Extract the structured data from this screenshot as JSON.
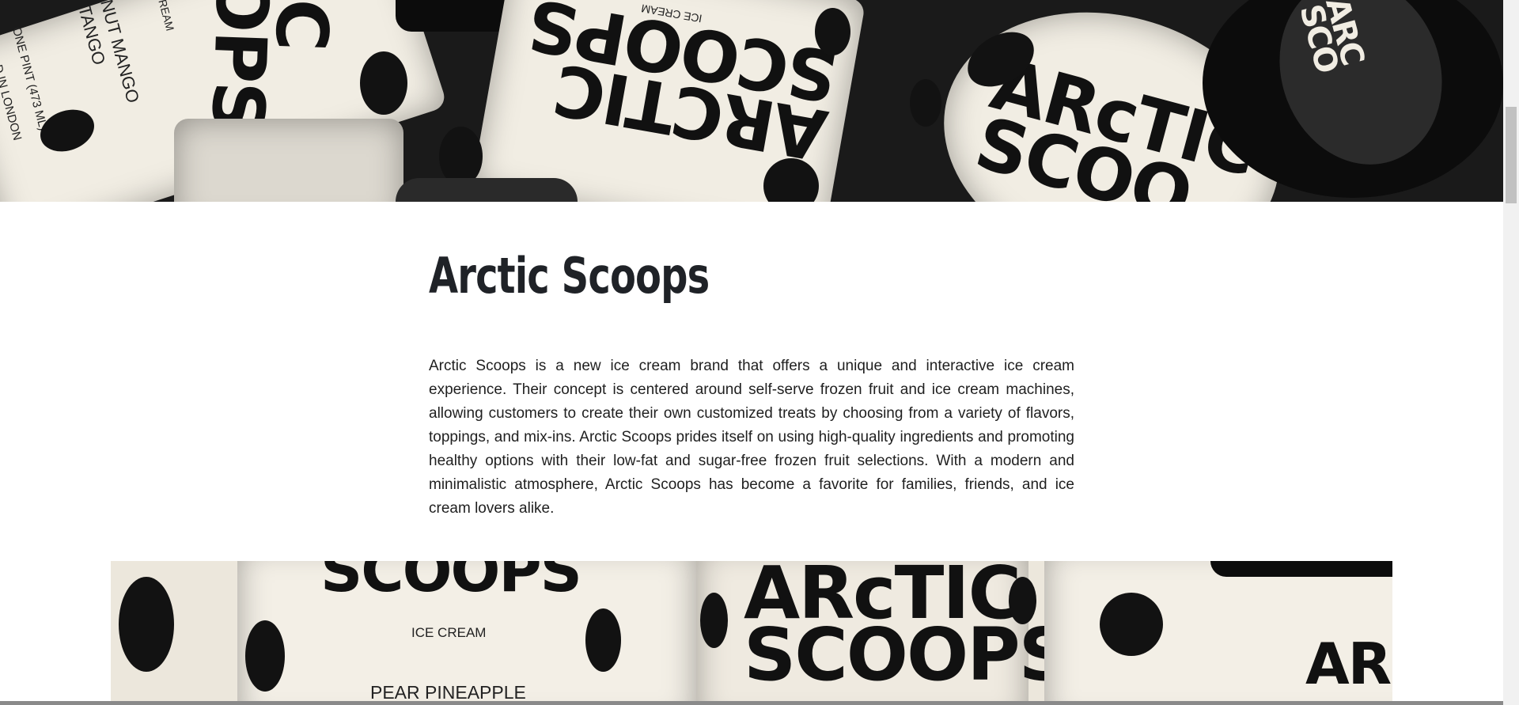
{
  "hero": {
    "tub_left_flavor": "NUT MANGO\nTANGO",
    "tub_left_size": "ONE PINT (473 ML)",
    "tub_left_made": "D IN LONDON",
    "tub_left_brand": "IC\nOPS",
    "tub_left_cream": "REAM",
    "tub_center_brand": "ARCTIC\nSCOOPS",
    "tub_center_cream": "ICE CREAM",
    "tub_right_brand": "ARcTIC\nSCOO",
    "tub_far_right_brand": "ARC\nSCO"
  },
  "article": {
    "title": "Arctic Scoops",
    "description": "Arctic Scoops is a new ice cream brand that offers a unique and interactive ice cream experience. Their concept is centered around self-serve frozen fruit and ice cream machines, allowing customers to create their own customized treats by choosing from a variety of flavors, toppings, and mix-ins. Arctic Scoops prides itself on using high-quality ingredients and promoting healthy options with their low-fat and sugar-free frozen fruit selections. With a modern and minimalistic atmosphere, Arctic Scoops has become a favorite for families, friends, and ice cream lovers alike."
  },
  "banner2": {
    "tub_left_brand": "SCOOPS",
    "tub_left_cream": "ICE CREAM",
    "tub_left_flavor": "PEAR PINEAPPLE",
    "tub_center_brand": "ARcTIC\nSCOOPS",
    "tub_right_brand": "AR"
  },
  "colors": {
    "title": "#1f2227",
    "text": "#1f1f1f",
    "tub": "#f1ede3",
    "dark": "#111111"
  }
}
